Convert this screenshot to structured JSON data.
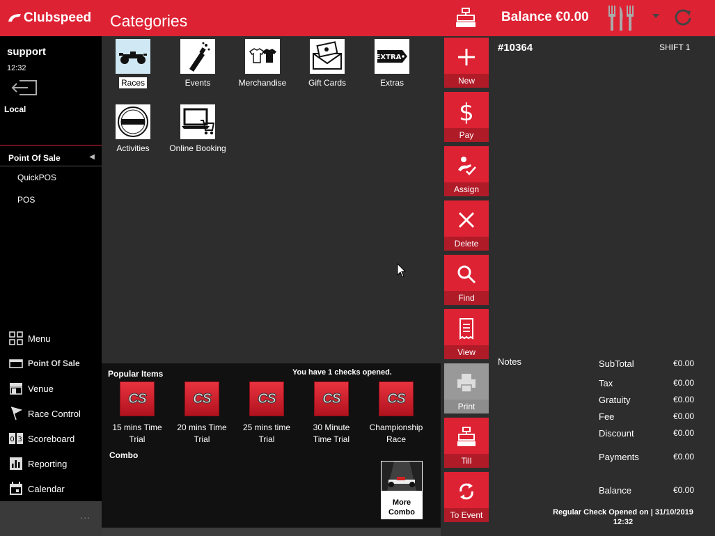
{
  "header": {
    "brand": "Clubspeed",
    "title": "Categories",
    "balance": "Balance €0.00",
    "accent_color": "#dd2233"
  },
  "sidebar": {
    "user": "support",
    "time": "12:32",
    "location": "Local",
    "section": "Point Of Sale",
    "section_items": [
      "QuickPOS",
      "POS"
    ],
    "nav": [
      {
        "label": "Menu",
        "icon": "grid-icon"
      },
      {
        "label": "Point Of Sale",
        "icon": "register-icon"
      },
      {
        "label": "Venue",
        "icon": "store-icon"
      },
      {
        "label": "Race Control",
        "icon": "flag-icon"
      },
      {
        "label": "Scoreboard",
        "icon": "scoreboard-icon"
      },
      {
        "label": "Reporting",
        "icon": "chart-icon"
      },
      {
        "label": "Calendar",
        "icon": "calendar-icon"
      }
    ],
    "footer": "..."
  },
  "categories": [
    {
      "label": "Races",
      "icon": "race-car-icon",
      "selected": true
    },
    {
      "label": "Events",
      "icon": "champagne-icon"
    },
    {
      "label": "Merchandise",
      "icon": "tshirt-icon"
    },
    {
      "label": "Gift Cards",
      "icon": "gift-card-icon"
    },
    {
      "label": "Extras",
      "icon": "extra-tag-icon"
    },
    {
      "label": "Activities",
      "icon": "activity-badge-icon"
    },
    {
      "label": "Online Booking",
      "icon": "laptop-cart-icon"
    }
  ],
  "popular": {
    "title": "Popular Items",
    "checks_message": "You have 1 checks opened.",
    "badge": "CS",
    "items": [
      {
        "line1": "15 mins Time",
        "line2": "Trial"
      },
      {
        "line1": "20 mins Time",
        "line2": "Trial"
      },
      {
        "line1": "25 mins time",
        "line2": "Trial"
      },
      {
        "line1": "30 Minute",
        "line2": "Time Trial"
      },
      {
        "line1": "Championship",
        "line2": "Race"
      }
    ],
    "combo_title": "Combo",
    "more_combo_line1": "More",
    "more_combo_line2": "Combo"
  },
  "actions": [
    {
      "label": "New",
      "icon": "plus-icon"
    },
    {
      "label": "Pay",
      "icon": "dollar-icon"
    },
    {
      "label": "Assign",
      "icon": "assign-icon"
    },
    {
      "label": "Delete",
      "icon": "close-icon"
    },
    {
      "label": "Find",
      "icon": "search-icon"
    },
    {
      "label": "View",
      "icon": "receipt-icon"
    },
    {
      "label": "Print",
      "icon": "printer-icon",
      "disabled": true
    },
    {
      "label": "Till",
      "icon": "till-icon"
    },
    {
      "label": "To Event",
      "icon": "transfer-icon"
    }
  ],
  "check": {
    "number": "#10364",
    "shift": "SHIFT 1",
    "notes_label": "Notes",
    "totals": [
      {
        "label": "SubTotal",
        "value": "€0.00"
      },
      {
        "label": "Tax",
        "value": "€0.00"
      },
      {
        "label": "Gratuity",
        "value": "€0.00"
      },
      {
        "label": "Fee",
        "value": "€0.00"
      },
      {
        "label": "Discount",
        "value": "€0.00"
      },
      {
        "label": "Payments",
        "value": "€0.00"
      },
      {
        "label": "Balance",
        "value": "€0.00"
      }
    ],
    "opened_line1": "Regular Check Opened on  |  31/10/2019",
    "opened_line2": "12:32"
  }
}
